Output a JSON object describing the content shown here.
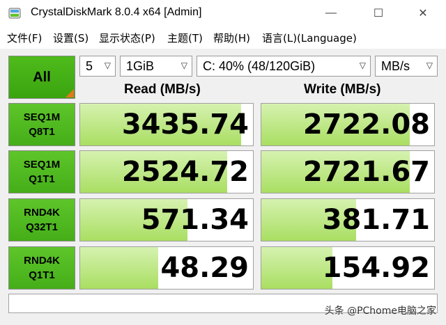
{
  "window": {
    "title": "CrystalDiskMark 8.0.4 x64 [Admin]",
    "minimize": "—",
    "maximize": "☐",
    "close": "✕"
  },
  "menu": [
    {
      "label": "文件(F)"
    },
    {
      "label": "设置(S)"
    },
    {
      "label": "显示状态(P)"
    },
    {
      "label": "主题(T)"
    },
    {
      "label": "帮助(H)"
    },
    {
      "label": "语言(L)(Language)"
    }
  ],
  "controls": {
    "all_label": "All",
    "count": "5",
    "size": "1GiB",
    "drive": "C: 40% (48/120GiB)",
    "unit": "MB/s"
  },
  "headers": {
    "read": "Read (MB/s)",
    "write": "Write (MB/s)"
  },
  "tests": [
    {
      "line1": "SEQ1M",
      "line2": "Q8T1",
      "read": "3435.74",
      "write": "2722.08",
      "read_level": 0.93,
      "write_level": 0.86
    },
    {
      "line1": "SEQ1M",
      "line2": "Q1T1",
      "read": "2524.72",
      "write": "2721.67",
      "read_level": 0.85,
      "write_level": 0.86
    },
    {
      "line1": "RND4K",
      "line2": "Q32T1",
      "read": "571.34",
      "write": "381.71",
      "read_level": 0.62,
      "write_level": 0.55
    },
    {
      "line1": "RND4K",
      "line2": "Q1T1",
      "read": "48.29",
      "write": "154.92",
      "read_level": 0.45,
      "write_level": 0.41
    }
  ],
  "watermark": "头条 @PChome电脑之家",
  "colors": {
    "accent_green": "#45ae18",
    "bar_green": "#a9de62",
    "corner_orange": "#e07a1c"
  }
}
